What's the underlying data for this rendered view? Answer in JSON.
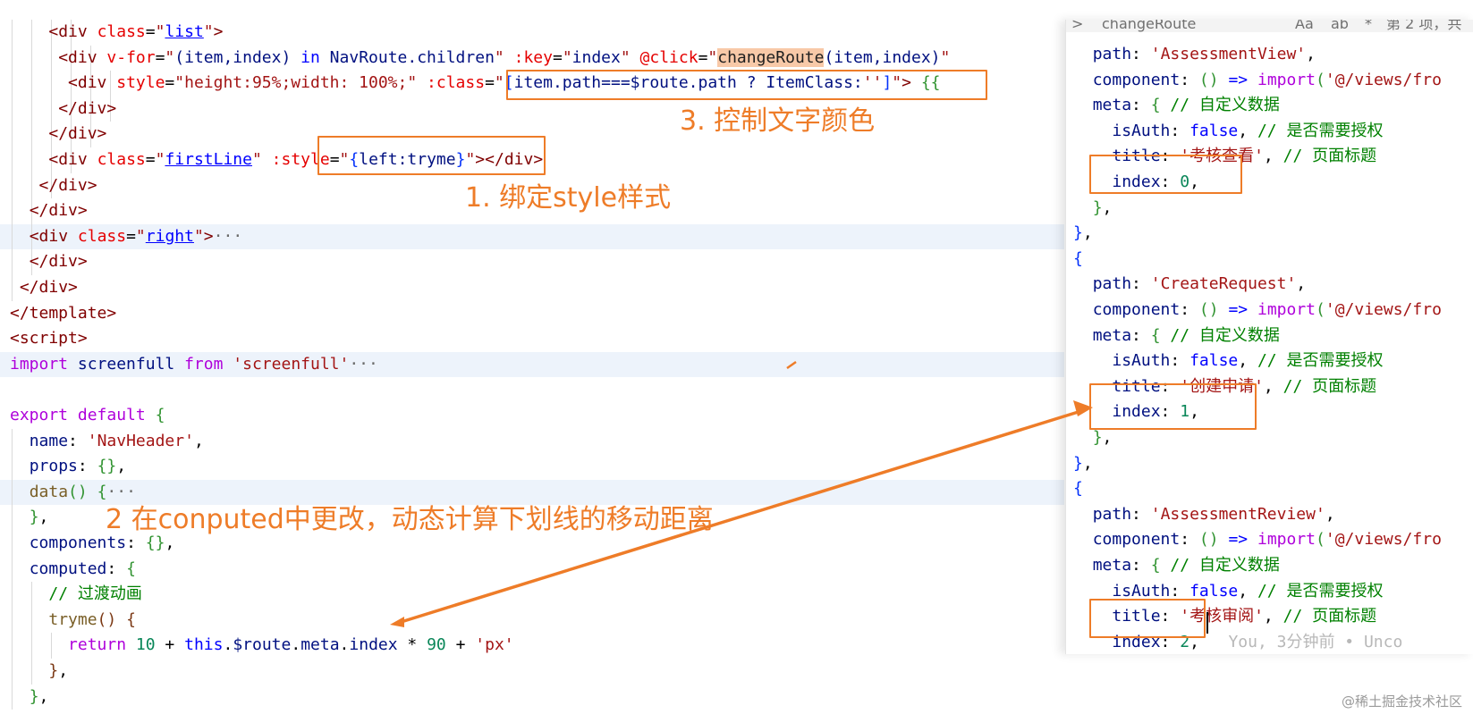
{
  "colors": {
    "annotation": "#ee7c28",
    "tag": "#800000",
    "attribute": "#e50000",
    "string": "#a31515",
    "keyword": "#0000ff",
    "comment": "#008000",
    "number": "#098658"
  },
  "find_widget": {
    "toggle": ">",
    "query": "changeRoute",
    "match_case": "Aa",
    "whole_word": "ab",
    "regex": "*",
    "result_count": "第 2 项，共"
  },
  "left_lines": [
    {
      "i": 4,
      "hl": false,
      "t": [
        [
          "t-plain",
          "    "
        ],
        [
          "t-tag",
          "<div"
        ],
        [
          "t-plain",
          " "
        ],
        [
          "t-attr",
          "class"
        ],
        [
          "t-plain",
          "="
        ],
        [
          "t-str",
          "\""
        ],
        [
          "t-ul",
          "list"
        ],
        [
          "t-str",
          "\""
        ],
        [
          "t-tag",
          ">"
        ]
      ]
    },
    {
      "i": 5,
      "hl": false,
      "t": [
        [
          "t-plain",
          "     "
        ],
        [
          "t-tag",
          "<div"
        ],
        [
          "t-plain",
          " "
        ],
        [
          "t-attr",
          "v-for"
        ],
        [
          "t-plain",
          "="
        ],
        [
          "t-str",
          "\""
        ],
        [
          "t-var",
          "(item,index) "
        ],
        [
          "t-kw",
          "in"
        ],
        [
          "t-var",
          " NavRoute.children"
        ],
        [
          "t-str",
          "\""
        ],
        [
          "t-plain",
          " "
        ],
        [
          "t-attr",
          ":key"
        ],
        [
          "t-plain",
          "="
        ],
        [
          "t-str",
          "\""
        ],
        [
          "t-var",
          "index"
        ],
        [
          "t-str",
          "\""
        ],
        [
          "t-plain",
          " "
        ],
        [
          "t-attr",
          "@click"
        ],
        [
          "t-plain",
          "="
        ],
        [
          "t-str",
          "\""
        ],
        [
          "t-search",
          "changeRoute"
        ],
        [
          "t-var",
          "(item,index)"
        ],
        [
          "t-str",
          "\""
        ]
      ]
    },
    {
      "i": 6,
      "hl": false,
      "t": [
        [
          "t-plain",
          "      "
        ],
        [
          "t-tag",
          "<div"
        ],
        [
          "t-plain",
          " "
        ],
        [
          "t-attr",
          "style"
        ],
        [
          "t-plain",
          "="
        ],
        [
          "t-str",
          "\"height:95%;width: 100%;\""
        ],
        [
          "t-plain",
          " "
        ],
        [
          "t-attr",
          ":class"
        ],
        [
          "t-plain",
          "="
        ],
        [
          "t-str",
          "\""
        ],
        [
          "t-br1",
          "["
        ],
        [
          "t-var",
          "item.path===$route.path ? ItemClass:"
        ],
        [
          "t-str",
          "''"
        ],
        [
          "t-br1",
          "]"
        ],
        [
          "t-str",
          "\""
        ],
        [
          "t-tag",
          ">"
        ],
        [
          "t-plain",
          " "
        ],
        [
          "t-br2",
          "{{"
        ]
      ]
    },
    {
      "i": 6,
      "hl": false,
      "t": [
        [
          "t-plain",
          "     "
        ],
        [
          "t-tag",
          "</div>"
        ]
      ]
    },
    {
      "i": 5,
      "hl": false,
      "t": [
        [
          "t-plain",
          "    "
        ],
        [
          "t-tag",
          "</div>"
        ]
      ]
    },
    {
      "i": 4,
      "hl": false,
      "t": [
        [
          "t-plain",
          "    "
        ],
        [
          "t-tag",
          "<div"
        ],
        [
          "t-plain",
          " "
        ],
        [
          "t-attr",
          "class"
        ],
        [
          "t-plain",
          "="
        ],
        [
          "t-str",
          "\""
        ],
        [
          "t-ul",
          "firstLine"
        ],
        [
          "t-str",
          "\""
        ],
        [
          "t-plain",
          " "
        ],
        [
          "t-attr",
          ":style"
        ],
        [
          "t-plain",
          "="
        ],
        [
          "t-str",
          "\""
        ],
        [
          "t-br1",
          "{"
        ],
        [
          "t-var",
          "left:tryme"
        ],
        [
          "t-br1",
          "}"
        ],
        [
          "t-str",
          "\""
        ],
        [
          "t-tag",
          ">"
        ],
        [
          "t-tag",
          "</div>"
        ]
      ]
    },
    {
      "i": 3,
      "hl": false,
      "t": [
        [
          "t-plain",
          "   "
        ],
        [
          "t-tag",
          "</div>"
        ]
      ]
    },
    {
      "i": 2,
      "hl": false,
      "t": [
        [
          "t-plain",
          "  "
        ],
        [
          "t-tag",
          "</div>"
        ]
      ]
    },
    {
      "i": 2,
      "hl": true,
      "t": [
        [
          "t-plain",
          "  "
        ],
        [
          "t-tag",
          "<div"
        ],
        [
          "t-plain",
          " "
        ],
        [
          "t-attr",
          "class"
        ],
        [
          "t-plain",
          "="
        ],
        [
          "t-str",
          "\""
        ],
        [
          "t-ul",
          "right"
        ],
        [
          "t-str",
          "\""
        ],
        [
          "t-tag",
          ">"
        ],
        [
          "t-fold",
          "···"
        ]
      ]
    },
    {
      "i": 2,
      "hl": false,
      "t": [
        [
          "t-plain",
          "  "
        ],
        [
          "t-tag",
          "</div>"
        ]
      ]
    },
    {
      "i": 1,
      "hl": false,
      "t": [
        [
          "t-plain",
          " "
        ],
        [
          "t-tag",
          "</div>"
        ]
      ]
    },
    {
      "i": 0,
      "hl": false,
      "t": [
        [
          "t-tag",
          "</template>"
        ]
      ]
    },
    {
      "i": 0,
      "hl": false,
      "t": [
        [
          "t-tag",
          "<script>"
        ]
      ]
    },
    {
      "i": 0,
      "hl": true,
      "t": [
        [
          "t-ctl",
          "import"
        ],
        [
          "t-plain",
          " "
        ],
        [
          "t-var",
          "screenfull"
        ],
        [
          "t-plain",
          " "
        ],
        [
          "t-ctl",
          "from"
        ],
        [
          "t-plain",
          " "
        ],
        [
          "t-str",
          "'screenfull'"
        ],
        [
          "t-fold",
          "···"
        ]
      ]
    },
    {
      "i": 0,
      "hl": false,
      "t": []
    },
    {
      "i": 0,
      "hl": false,
      "t": [
        [
          "t-ctl",
          "export"
        ],
        [
          "t-plain",
          " "
        ],
        [
          "t-ctl",
          "default"
        ],
        [
          "t-plain",
          " "
        ],
        [
          "t-br2",
          "{"
        ]
      ]
    },
    {
      "i": 1,
      "hl": false,
      "t": [
        [
          "t-plain",
          "  "
        ],
        [
          "t-var",
          "name"
        ],
        [
          "t-plain",
          ": "
        ],
        [
          "t-str",
          "'NavHeader'"
        ],
        [
          "t-plain",
          ","
        ]
      ]
    },
    {
      "i": 1,
      "hl": false,
      "t": [
        [
          "t-plain",
          "  "
        ],
        [
          "t-var",
          "props"
        ],
        [
          "t-plain",
          ": "
        ],
        [
          "t-br2",
          "{}"
        ],
        [
          "t-plain",
          ","
        ]
      ]
    },
    {
      "i": 1,
      "hl": true,
      "t": [
        [
          "t-plain",
          "  "
        ],
        [
          "t-fn",
          "data"
        ],
        [
          "t-br2",
          "()"
        ],
        [
          "t-plain",
          " "
        ],
        [
          "t-br2",
          "{"
        ],
        [
          "t-fold",
          "···"
        ]
      ]
    },
    {
      "i": 1,
      "hl": false,
      "t": [
        [
          "t-plain",
          "  "
        ],
        [
          "t-br2",
          "}"
        ],
        [
          "t-plain",
          ","
        ]
      ]
    },
    {
      "i": 1,
      "hl": false,
      "t": [
        [
          "t-plain",
          "  "
        ],
        [
          "t-var",
          "components"
        ],
        [
          "t-plain",
          ": "
        ],
        [
          "t-br2",
          "{}"
        ],
        [
          "t-plain",
          ","
        ]
      ]
    },
    {
      "i": 1,
      "hl": false,
      "t": [
        [
          "t-plain",
          "  "
        ],
        [
          "t-var",
          "computed"
        ],
        [
          "t-plain",
          ": "
        ],
        [
          "t-br2",
          "{"
        ]
      ]
    },
    {
      "i": 2,
      "hl": false,
      "t": [
        [
          "t-plain",
          "    "
        ],
        [
          "t-cmt",
          "// 过渡动画"
        ]
      ]
    },
    {
      "i": 2,
      "hl": false,
      "t": [
        [
          "t-plain",
          "    "
        ],
        [
          "t-fn",
          "tryme"
        ],
        [
          "t-br3",
          "()"
        ],
        [
          "t-plain",
          " "
        ],
        [
          "t-br3",
          "{"
        ]
      ]
    },
    {
      "i": 3,
      "hl": false,
      "t": [
        [
          "t-plain",
          "      "
        ],
        [
          "t-ctl",
          "return"
        ],
        [
          "t-plain",
          " "
        ],
        [
          "t-num",
          "10"
        ],
        [
          "t-plain",
          " + "
        ],
        [
          "t-kw",
          "this"
        ],
        [
          "t-plain",
          "."
        ],
        [
          "t-var",
          "$route"
        ],
        [
          "t-plain",
          "."
        ],
        [
          "t-var",
          "meta"
        ],
        [
          "t-plain",
          "."
        ],
        [
          "t-var",
          "index"
        ],
        [
          "t-plain",
          " * "
        ],
        [
          "t-num",
          "90"
        ],
        [
          "t-plain",
          " + "
        ],
        [
          "t-str",
          "'px'"
        ]
      ]
    },
    {
      "i": 2,
      "hl": false,
      "t": [
        [
          "t-plain",
          "    "
        ],
        [
          "t-br3",
          "}"
        ],
        [
          "t-plain",
          ","
        ]
      ]
    },
    {
      "i": 1,
      "hl": false,
      "t": [
        [
          "t-plain",
          "  "
        ],
        [
          "t-br2",
          "}"
        ],
        [
          "t-plain",
          ","
        ]
      ]
    }
  ],
  "right_lines": [
    {
      "t": [
        [
          "t-plain",
          "  "
        ],
        [
          "t-var",
          "path"
        ],
        [
          "t-plain",
          ": "
        ],
        [
          "t-str",
          "'AssessmentView'"
        ],
        [
          "t-plain",
          ","
        ]
      ]
    },
    {
      "t": [
        [
          "t-plain",
          "  "
        ],
        [
          "t-var",
          "component"
        ],
        [
          "t-plain",
          ": "
        ],
        [
          "t-br2",
          "()"
        ],
        [
          "t-plain",
          " "
        ],
        [
          "t-kw",
          "=>"
        ],
        [
          "t-plain",
          " "
        ],
        [
          "t-ctl",
          "import"
        ],
        [
          "t-br2",
          "("
        ],
        [
          "t-str",
          "'@/views/fro"
        ]
      ]
    },
    {
      "t": [
        [
          "t-plain",
          "  "
        ],
        [
          "t-var",
          "meta"
        ],
        [
          "t-plain",
          ": "
        ],
        [
          "t-br2",
          "{"
        ],
        [
          "t-plain",
          " "
        ],
        [
          "t-cmt",
          "// 自定义数据"
        ]
      ]
    },
    {
      "t": [
        [
          "t-plain",
          "    "
        ],
        [
          "t-var",
          "isAuth"
        ],
        [
          "t-plain",
          ": "
        ],
        [
          "t-kw",
          "false"
        ],
        [
          "t-plain",
          ", "
        ],
        [
          "t-cmt",
          "// 是否需要授权"
        ]
      ]
    },
    {
      "t": [
        [
          "t-plain",
          "    "
        ],
        [
          "t-var",
          "title"
        ],
        [
          "t-plain",
          ": "
        ],
        [
          "t-str",
          "'考核查看'"
        ],
        [
          "t-plain",
          ", "
        ],
        [
          "t-cmt",
          "// 页面标题"
        ]
      ]
    },
    {
      "t": [
        [
          "t-plain",
          "    "
        ],
        [
          "t-var",
          "index"
        ],
        [
          "t-plain",
          ": "
        ],
        [
          "t-num",
          "0"
        ],
        [
          "t-plain",
          ","
        ]
      ]
    },
    {
      "t": [
        [
          "t-plain",
          "  "
        ],
        [
          "t-br2",
          "}"
        ],
        [
          "t-plain",
          ","
        ]
      ]
    },
    {
      "t": [
        [
          "t-br1",
          "}"
        ],
        [
          "t-plain",
          ","
        ]
      ]
    },
    {
      "t": [
        [
          "t-br1",
          "{"
        ]
      ]
    },
    {
      "t": [
        [
          "t-plain",
          "  "
        ],
        [
          "t-var",
          "path"
        ],
        [
          "t-plain",
          ": "
        ],
        [
          "t-str",
          "'CreateRequest'"
        ],
        [
          "t-plain",
          ","
        ]
      ]
    },
    {
      "t": [
        [
          "t-plain",
          "  "
        ],
        [
          "t-var",
          "component"
        ],
        [
          "t-plain",
          ": "
        ],
        [
          "t-br2",
          "()"
        ],
        [
          "t-plain",
          " "
        ],
        [
          "t-kw",
          "=>"
        ],
        [
          "t-plain",
          " "
        ],
        [
          "t-ctl",
          "import"
        ],
        [
          "t-br2",
          "("
        ],
        [
          "t-str",
          "'@/views/fro"
        ]
      ]
    },
    {
      "t": [
        [
          "t-plain",
          "  "
        ],
        [
          "t-var",
          "meta"
        ],
        [
          "t-plain",
          ": "
        ],
        [
          "t-br2",
          "{"
        ],
        [
          "t-plain",
          " "
        ],
        [
          "t-cmt",
          "// 自定义数据"
        ]
      ]
    },
    {
      "t": [
        [
          "t-plain",
          "    "
        ],
        [
          "t-var",
          "isAuth"
        ],
        [
          "t-plain",
          ": "
        ],
        [
          "t-kw",
          "false"
        ],
        [
          "t-plain",
          ", "
        ],
        [
          "t-cmt",
          "// 是否需要授权"
        ]
      ]
    },
    {
      "t": [
        [
          "t-plain",
          "    "
        ],
        [
          "t-var",
          "title"
        ],
        [
          "t-plain",
          ": "
        ],
        [
          "t-str",
          "'创建申请'"
        ],
        [
          "t-plain",
          ", "
        ],
        [
          "t-cmt",
          "// 页面标题"
        ]
      ]
    },
    {
      "t": [
        [
          "t-plain",
          "    "
        ],
        [
          "t-var",
          "index"
        ],
        [
          "t-plain",
          ": "
        ],
        [
          "t-num",
          "1"
        ],
        [
          "t-plain",
          ","
        ]
      ]
    },
    {
      "t": [
        [
          "t-plain",
          "  "
        ],
        [
          "t-br2",
          "}"
        ],
        [
          "t-plain",
          ","
        ]
      ]
    },
    {
      "t": [
        [
          "t-br1",
          "}"
        ],
        [
          "t-plain",
          ","
        ]
      ]
    },
    {
      "t": [
        [
          "t-br1",
          "{"
        ]
      ]
    },
    {
      "t": [
        [
          "t-plain",
          "  "
        ],
        [
          "t-var",
          "path"
        ],
        [
          "t-plain",
          ": "
        ],
        [
          "t-str",
          "'AssessmentReview'"
        ],
        [
          "t-plain",
          ","
        ]
      ]
    },
    {
      "t": [
        [
          "t-plain",
          "  "
        ],
        [
          "t-var",
          "component"
        ],
        [
          "t-plain",
          ": "
        ],
        [
          "t-br2",
          "()"
        ],
        [
          "t-plain",
          " "
        ],
        [
          "t-kw",
          "=>"
        ],
        [
          "t-plain",
          " "
        ],
        [
          "t-ctl",
          "import"
        ],
        [
          "t-br2",
          "("
        ],
        [
          "t-str",
          "'@/views/fro"
        ]
      ]
    },
    {
      "t": [
        [
          "t-plain",
          "  "
        ],
        [
          "t-var",
          "meta"
        ],
        [
          "t-plain",
          ": "
        ],
        [
          "t-br2",
          "{"
        ],
        [
          "t-plain",
          " "
        ],
        [
          "t-cmt",
          "// 自定义数据"
        ]
      ]
    },
    {
      "t": [
        [
          "t-plain",
          "    "
        ],
        [
          "t-var",
          "isAuth"
        ],
        [
          "t-plain",
          ": "
        ],
        [
          "t-kw",
          "false"
        ],
        [
          "t-plain",
          ", "
        ],
        [
          "t-cmt",
          "// 是否需要授权"
        ]
      ]
    },
    {
      "t": [
        [
          "t-plain",
          "    "
        ],
        [
          "t-var",
          "title"
        ],
        [
          "t-plain",
          ": "
        ],
        [
          "t-str",
          "'考核审阅'"
        ],
        [
          "t-plain",
          ", "
        ],
        [
          "t-cmt",
          "// 页面标题"
        ]
      ]
    },
    {
      "t": [
        [
          "t-plain",
          "    "
        ],
        [
          "t-var",
          "index"
        ],
        [
          "t-plain",
          ": "
        ],
        [
          "t-num",
          "2"
        ],
        [
          "t-plain",
          ","
        ],
        [
          "t-plain",
          "   "
        ],
        [
          "t-ghost",
          "You, 3分钟前 • Unco"
        ]
      ]
    }
  ],
  "annotations": {
    "style_binding": "1. 绑定style样式",
    "computed_note": "2 在conputed中更改，动态计算下划线的移动距离",
    "class_color": "3. 控制文字颜色"
  },
  "watermark": "@稀土掘金技术社区"
}
